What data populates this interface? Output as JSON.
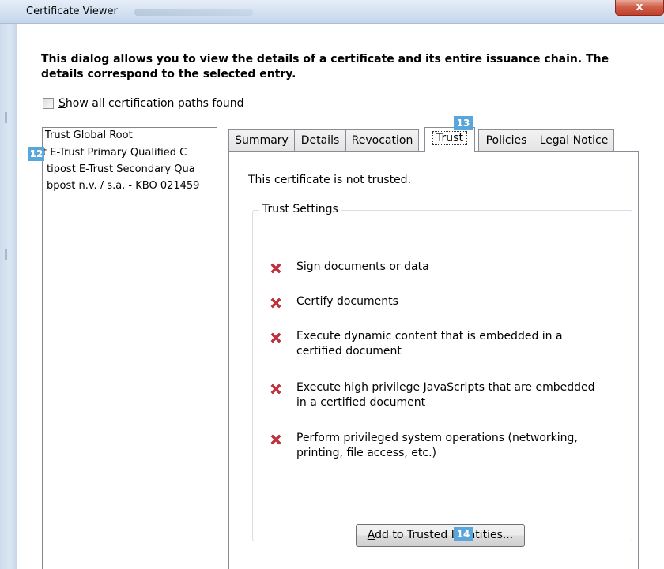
{
  "window": {
    "title": "Certificate Viewer",
    "close_label": "x"
  },
  "intro_text": "This dialog allows you to view the details of a certificate and its entire issuance chain. The details correspond to the selected entry.",
  "show_all": {
    "accel": "S",
    "label_rest": "how all certification paths found",
    "checked": false
  },
  "chain": [
    "Trust Global Root",
    "t E-Trust Primary Qualified C",
    "tipost E-Trust Secondary Qua",
    " bpost n.v. / s.a. - KBO 021459"
  ],
  "badges": {
    "list": "12",
    "tab": "13",
    "button": "14"
  },
  "tabs": [
    {
      "label": "Summary",
      "active": false
    },
    {
      "label": "Details",
      "active": false
    },
    {
      "label": "Revocation",
      "active": false
    },
    {
      "label": "Trust",
      "active": true
    },
    {
      "label": "Policies",
      "active": false
    },
    {
      "label": "Legal Notice",
      "active": false
    }
  ],
  "trust": {
    "status": "This certificate is not trusted.",
    "group_title": "Trust Settings",
    "items": [
      {
        "icon": "red-x-icon",
        "text": "Sign documents or data"
      },
      {
        "icon": "red-x-icon",
        "text": "Certify documents"
      },
      {
        "icon": "red-x-icon",
        "text": "Execute dynamic content that is embedded in a certified document"
      },
      {
        "icon": "red-x-icon",
        "text": "Execute high privilege JavaScripts that are embedded in a certified document"
      },
      {
        "icon": "red-x-icon",
        "text": "Perform privileged system operations (networking, printing, file access, etc.)"
      }
    ],
    "add_button": {
      "accel": "A",
      "label_rest": "dd to Trusted Identities..."
    }
  },
  "colors": {
    "x_icon": "#c8323c",
    "badge": "#58a6dc",
    "close_button": "#c1402a"
  }
}
